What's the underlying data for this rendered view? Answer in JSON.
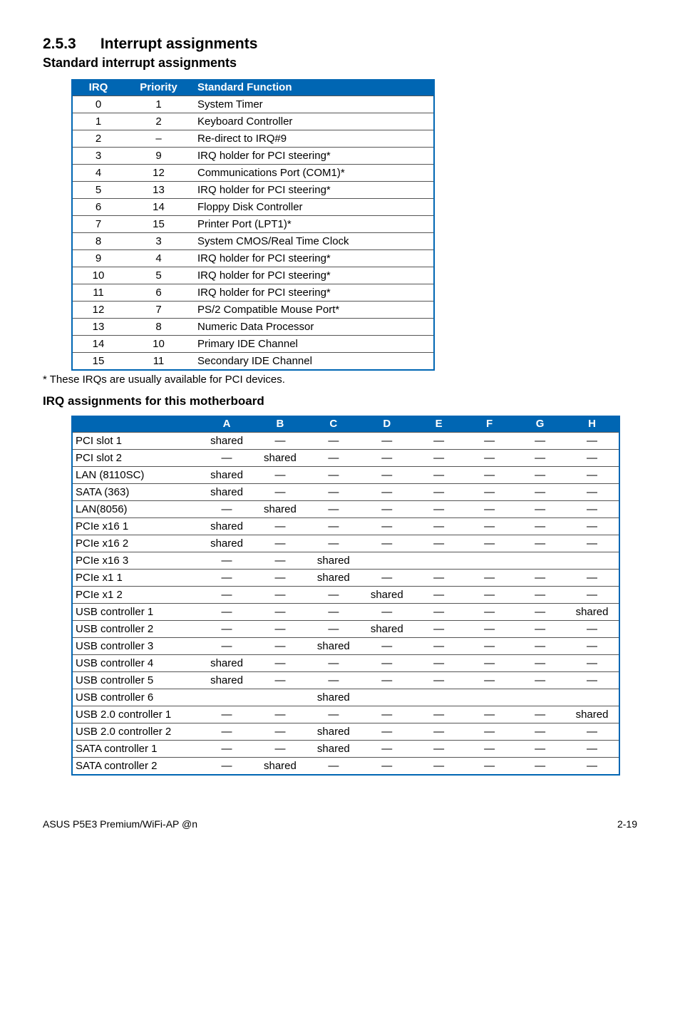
{
  "section_number": "2.5.3",
  "section_title": "Interrupt assignments",
  "sub1": "Standard interrupt assignments",
  "table1": {
    "headers": {
      "irq": "IRQ",
      "priority": "Priority",
      "fn": "Standard Function"
    },
    "rows": [
      {
        "irq": "0",
        "pri": "1",
        "fn": "System Timer"
      },
      {
        "irq": "1",
        "pri": "2",
        "fn": "Keyboard Controller"
      },
      {
        "irq": "2",
        "pri": "–",
        "fn": "Re-direct to IRQ#9"
      },
      {
        "irq": "3",
        "pri": "9",
        "fn": "IRQ holder for PCI steering*"
      },
      {
        "irq": "4",
        "pri": "12",
        "fn": "Communications Port (COM1)*"
      },
      {
        "irq": "5",
        "pri": "13",
        "fn": "IRQ holder for PCI steering*"
      },
      {
        "irq": "6",
        "pri": "14",
        "fn": "Floppy Disk Controller"
      },
      {
        "irq": "7",
        "pri": "15",
        "fn": "Printer Port (LPT1)*"
      },
      {
        "irq": "8",
        "pri": "3",
        "fn": "System CMOS/Real Time Clock"
      },
      {
        "irq": "9",
        "pri": "4",
        "fn": "IRQ holder for PCI steering*"
      },
      {
        "irq": "10",
        "pri": "5",
        "fn": "IRQ holder for PCI steering*"
      },
      {
        "irq": "11",
        "pri": "6",
        "fn": "IRQ holder for PCI steering*"
      },
      {
        "irq": "12",
        "pri": "7",
        "fn": "PS/2 Compatible Mouse Port*"
      },
      {
        "irq": "13",
        "pri": "8",
        "fn": "Numeric Data Processor"
      },
      {
        "irq": "14",
        "pri": "10",
        "fn": "Primary IDE Channel"
      },
      {
        "irq": "15",
        "pri": "11",
        "fn": "Secondary IDE Channel"
      }
    ]
  },
  "footnote": "* These IRQs are usually available for PCI devices.",
  "sub2": "IRQ assignments for this motherboard",
  "table2": {
    "cols": [
      "A",
      "B",
      "C",
      "D",
      "E",
      "F",
      "G",
      "H"
    ],
    "rows": [
      {
        "label": "PCI slot 1",
        "cells": [
          "shared",
          "—",
          "—",
          "—",
          "—",
          "—",
          "—",
          "—"
        ]
      },
      {
        "label": "PCI slot 2",
        "cells": [
          "—",
          "shared",
          "—",
          "—",
          "—",
          "—",
          "—",
          "—"
        ]
      },
      {
        "label": "LAN (8110SC)",
        "cells": [
          "shared",
          "—",
          "—",
          "—",
          "—",
          "—",
          "—",
          "—"
        ]
      },
      {
        "label": "SATA (363)",
        "cells": [
          "shared",
          "—",
          "—",
          "—",
          "—",
          "—",
          "—",
          "—"
        ]
      },
      {
        "label": "LAN(8056)",
        "cells": [
          "—",
          "shared",
          "—",
          "—",
          "—",
          "—",
          "—",
          "—"
        ]
      },
      {
        "label": "PCIe x16 1",
        "cells": [
          "shared",
          "—",
          "—",
          "—",
          "—",
          "—",
          "—",
          "—"
        ]
      },
      {
        "label": "PCIe x16 2",
        "cells": [
          "shared",
          "—",
          "—",
          "—",
          "—",
          "—",
          "—",
          "—"
        ]
      },
      {
        "label": "PCIe x16 3",
        "cells": [
          "—",
          "—",
          "shared",
          "",
          "",
          "",
          "",
          ""
        ]
      },
      {
        "label": "PCIe x1 1",
        "cells": [
          "—",
          "—",
          "shared",
          "—",
          "—",
          "—",
          "—",
          "—"
        ]
      },
      {
        "label": "PCIe x1 2",
        "cells": [
          "—",
          "—",
          "—",
          "shared",
          "—",
          "—",
          "—",
          "—"
        ]
      },
      {
        "label": "USB controller 1",
        "cells": [
          "—",
          "—",
          "—",
          "—",
          "—",
          "—",
          "—",
          "shared"
        ]
      },
      {
        "label": "USB controller 2",
        "cells": [
          "—",
          "—",
          "—",
          "shared",
          "—",
          "—",
          "—",
          "—"
        ]
      },
      {
        "label": "USB controller 3",
        "cells": [
          "—",
          "—",
          "shared",
          "—",
          "—",
          "—",
          "—",
          "—"
        ]
      },
      {
        "label": "USB controller 4",
        "cells": [
          "shared",
          "—",
          "—",
          "—",
          "—",
          "—",
          "—",
          "—"
        ]
      },
      {
        "label": "USB controller 5",
        "cells": [
          "shared",
          "—",
          "—",
          "—",
          "—",
          "—",
          "—",
          "—"
        ]
      },
      {
        "label": "USB controller 6",
        "cells": [
          "",
          "",
          "shared",
          "",
          "",
          "",
          "",
          ""
        ]
      },
      {
        "label": "USB 2.0 controller 1",
        "cells": [
          "—",
          "—",
          "—",
          "—",
          "—",
          "—",
          "—",
          "shared"
        ]
      },
      {
        "label": "USB 2.0 controller 2",
        "cells": [
          "—",
          "—",
          "shared",
          "—",
          "—",
          "—",
          "—",
          "—"
        ]
      },
      {
        "label": "SATA controller 1",
        "cells": [
          "—",
          "—",
          "shared",
          "—",
          "—",
          "—",
          "—",
          "—"
        ]
      },
      {
        "label": "SATA controller 2",
        "cells": [
          "—",
          "shared",
          "—",
          "—",
          "—",
          "—",
          "—",
          "—"
        ]
      }
    ]
  },
  "footer_left": "ASUS P5E3 Premium/WiFi-AP @n",
  "footer_right": "2-19"
}
